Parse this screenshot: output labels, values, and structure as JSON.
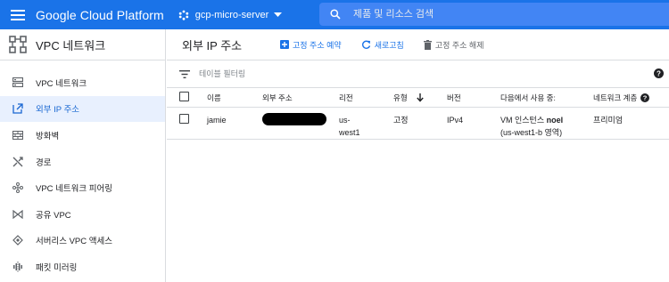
{
  "topbar": {
    "app_title": "Google Cloud Platform",
    "project_name": "gcp-micro-server",
    "search_placeholder": "제품 및 리소스 검색"
  },
  "sidebar": {
    "title": "VPC 네트워크",
    "items": [
      {
        "label": "VPC 네트워크",
        "icon": "vpc-network-icon"
      },
      {
        "label": "외부 IP 주소",
        "icon": "external-ip-icon",
        "active": true
      },
      {
        "label": "방화벽",
        "icon": "firewall-icon"
      },
      {
        "label": "경로",
        "icon": "routes-icon"
      },
      {
        "label": "VPC 네트워크 피어링",
        "icon": "peering-icon"
      },
      {
        "label": "공유 VPC",
        "icon": "shared-vpc-icon"
      },
      {
        "label": "서버리스 VPC 액세스",
        "icon": "serverless-icon"
      },
      {
        "label": "패킷 미러링",
        "icon": "packet-mirroring-icon"
      }
    ]
  },
  "toolbar": {
    "page_title": "외부 IP 주소",
    "reserve_label": "고정 주소 예약",
    "refresh_label": "새로고침",
    "release_label": "고정 주소 해제"
  },
  "filter": {
    "placeholder": "테이블 필터링"
  },
  "table": {
    "headers": {
      "name": "이름",
      "address": "외부 주소",
      "region": "리전",
      "type": "유형",
      "version": "버전",
      "used_by": "다음에서 사용 중:",
      "tier": "네트워크 계층"
    },
    "rows": [
      {
        "name": "jamie",
        "region_line1": "us-",
        "region_line2": "west1",
        "type": "고정",
        "version": "IPv4",
        "used_by_prefix": "VM 인스턴스 ",
        "used_by_name": "noel",
        "used_by_zone": "(us-west1-b 영역)",
        "tier": "프리미엄"
      }
    ]
  },
  "colors": {
    "brand_blue": "#1a73e8",
    "search_blue": "#4285f4",
    "active_bg": "#e8f0fe",
    "active_text": "#1967d2"
  }
}
